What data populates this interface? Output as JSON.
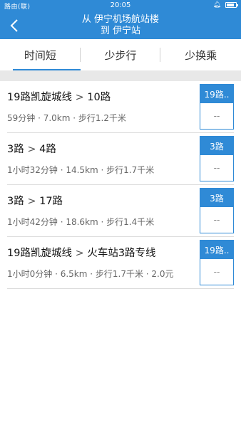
{
  "status_bar": {
    "left": "路由(联)",
    "time": "20:05",
    "right_icon": "bell-icon"
  },
  "nav": {
    "title_line1": "从 伊宁机场航站楼",
    "title_line2": "到 伊宁站"
  },
  "tabs": [
    {
      "label": "时间短",
      "active": true
    },
    {
      "label": "少步行",
      "active": false
    },
    {
      "label": "少换乘",
      "active": false
    }
  ],
  "routes": [
    {
      "segments": [
        "19路凯旋城线",
        "10路"
      ],
      "meta": "59分钟 · 7.0km · 步行1.2千米",
      "badge_top": "19路..",
      "badge_bottom": "--"
    },
    {
      "segments": [
        "3路",
        "4路"
      ],
      "meta": "1小时32分钟 · 14.5km · 步行1.7千米",
      "badge_top": "3路",
      "badge_bottom": "--"
    },
    {
      "segments": [
        "3路",
        "17路"
      ],
      "meta": "1小时42分钟 · 18.6km · 步行1.4千米",
      "badge_top": "3路",
      "badge_bottom": "--"
    },
    {
      "segments": [
        "19路凯旋城线",
        "火车站3路专线"
      ],
      "meta": "1小时0分钟 · 6.5km · 步行1.7千米 · 2.0元",
      "badge_top": "19路..",
      "badge_bottom": "--"
    }
  ],
  "colors": {
    "accent": "#2f8ad6",
    "band": "#e8e8e8"
  }
}
